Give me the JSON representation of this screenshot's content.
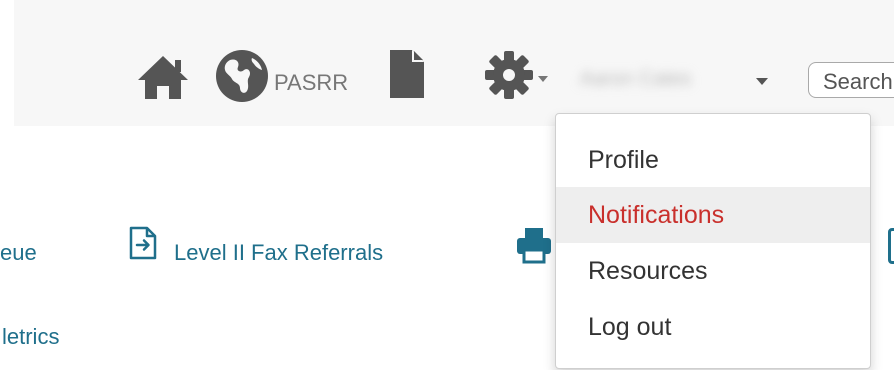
{
  "navbar": {
    "home_icon": "home-icon",
    "globe_icon": "globe-icon",
    "globe_label": "PASRR",
    "document_icon": "document-icon",
    "settings_icon": "gear-icon",
    "user_name": "Aaron Cates",
    "search_placeholder": "Search"
  },
  "user_menu": {
    "items": [
      {
        "label": "Profile"
      },
      {
        "label": "Notifications",
        "highlighted": true
      },
      {
        "label": "Resources"
      },
      {
        "label": "Log out"
      }
    ]
  },
  "content": {
    "queue_link": "eue",
    "fax_referrals_link": "Level II Fax Referrals",
    "metrics_link": "letrics"
  },
  "colors": {
    "link": "#1f6f8b",
    "icon": "#555555",
    "highlight_text": "#c9302c",
    "highlight_bg": "#eeeeee",
    "navbar_bg": "#f7f7f7"
  }
}
